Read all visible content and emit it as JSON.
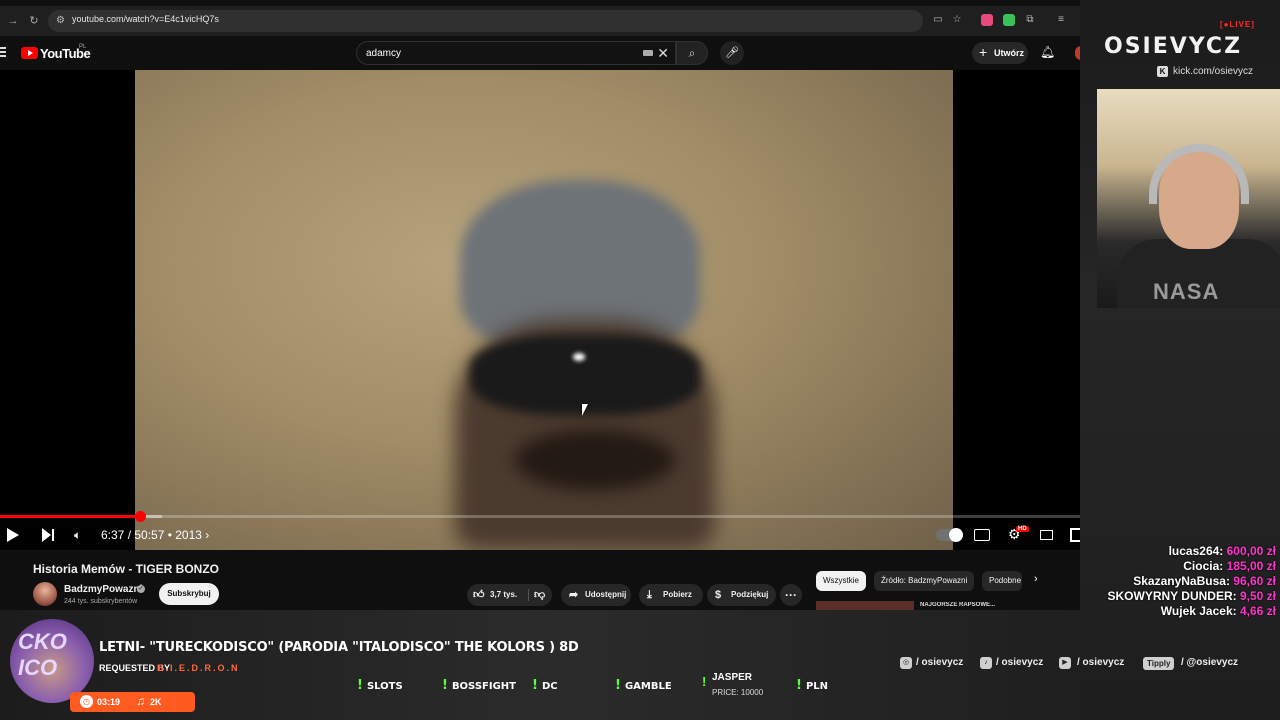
{
  "browser": {
    "url": "youtube.com/watch?v=E4c1vicHQ7s"
  },
  "youtube": {
    "logo_text": "YouTube",
    "region": "PL",
    "search_query": "adamcy",
    "create_label": "Utwórz"
  },
  "player": {
    "time": "6:37 / 50:57 • 2013 ›",
    "progress_fraction": 0.13,
    "buffered_fraction": 0.15,
    "hd_badge": "HD"
  },
  "video": {
    "title": "Historia Memów - TIGER BONZO",
    "channel_name": "BadzmyPowazni",
    "channel_subs": "244 tys. subskrybentów",
    "subscribe_label": "Subskrybuj",
    "likes": "3,7 tys.",
    "share_label": "Udostępnij",
    "download_label": "Pobierz",
    "thanks_label": "Podziękuj",
    "more_label": "···"
  },
  "related": {
    "chips": [
      "Wszystkie",
      "Źródło: BadzmyPowazni",
      "Podobne"
    ],
    "first_title": "NAJGORSZE RAPSOWE..."
  },
  "stream": {
    "live_label": "[●LIVE]",
    "brand": "OSIEVYCZ",
    "kick_link": "kick.com/osievycz",
    "shirt_text": "NASA",
    "donations": [
      {
        "name": "lucas264:",
        "amount": "600,00 zł"
      },
      {
        "name": "Ciocia:",
        "amount": "185,00 zł"
      },
      {
        "name": "SkazanyNaBusa:",
        "amount": "96,60 zł"
      },
      {
        "name": "SKOWYRNY DUNDER:",
        "amount": "9,50 zł"
      },
      {
        "name": "Wujek Jacek:",
        "amount": "4,66 zł"
      }
    ],
    "song": {
      "title": "LETNI- \"TURECKODISCO\" (PARODIA \"ITALODISCO\" THE KOLORS ) 8D",
      "requested_label": "REQUESTED BY",
      "requested_by": "B.I.E.D.R.O.N",
      "duration": "03:19",
      "count": "2K",
      "art_text": "CKO ICO"
    },
    "commands": [
      {
        "label": "SLOTS"
      },
      {
        "label": "BOSSFIGHT"
      },
      {
        "label": "DC"
      },
      {
        "label": "GAMBLE"
      },
      {
        "label": "JASPER",
        "sub": "PRICE: 10000"
      },
      {
        "label": "PLN"
      }
    ],
    "socials": {
      "instagram": "/ osievycz",
      "tiktok": "/ osievycz",
      "youtube": "/ osievycz",
      "tipply_badge": "Tipply",
      "tipply": "/ @osievycz"
    }
  }
}
